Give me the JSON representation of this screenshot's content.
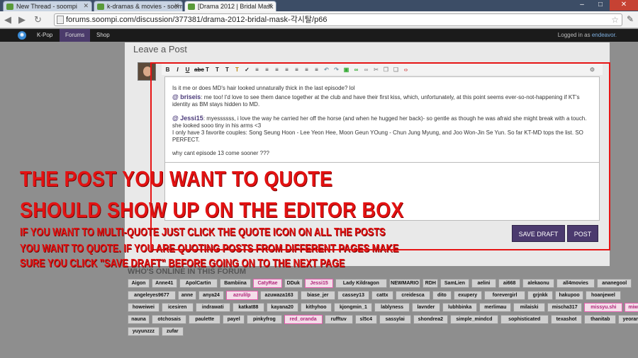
{
  "browser": {
    "tabs": [
      {
        "title": "New Thread - soompi"
      },
      {
        "title": "k-dramas & movies - soompi"
      },
      {
        "title": "[Drama 2012 | Bridal Mask"
      }
    ],
    "url": "forums.soompi.com/discussion/377381/drama-2012-bridal-mask-각시탈/p66"
  },
  "site_nav": {
    "items": [
      "K-Pop",
      "Forums",
      "Shop"
    ],
    "logged_in_label": "Logged in as",
    "username": "endeavor."
  },
  "editor": {
    "heading": "Leave a Post",
    "line1": "Is it me or does MD's hair looked unnaturally thick in the last episode? lol",
    "quote1_user": "@ briseis",
    "quote1_text": ": me too! I'd love to see them dance together at the club and have their first kiss, which, unfortunately, at this point seems ever-so-not-happening if KT's identity as BM stays hidden to MD.",
    "quote2_user": "@ Jessi15",
    "quote2_text": ":  myessssss, i love the way he carried her off the horse (and when he hugged her back)- so gentle as though he was afraid she might break with a touch. she looked sooo tiny in his arms <3",
    "line3": "I only have 3 favorite couples: Song Seung Hoon - Lee Yeon Hee, Moon Geun YOung - Chun Jung Myung, and Joo Won-Jin Se Yun. So far KT-MD tops the list. SO PERFECT.",
    "line4": "why cant episode 13 come sooner ???",
    "save_draft": "SAVE DRAFT",
    "post": "POST"
  },
  "overlay": {
    "line1": "THE POST YOU WANT TO QUOTE",
    "line2": "SHOULD SHOW UP ON THE EDITOR BOX",
    "line3": "IF YOU WANT TO MULTI-QUOTE JUST CLICK THE QUOTE ICON ON ALL THE POSTS",
    "line4": "YOU WANT TO QUOTE. IF YOU ARE QUOTING POSTS FROM DIFFERENT PAGES MAKE",
    "line5": "SURE YOU CLICK \"SAVE DRAFT\" BEFORE GOING ON TO THE NEXT PAGE"
  },
  "online": {
    "heading": "WHO'S ONLINE IN THIS FORUM",
    "rows": [
      [
        "Aigon",
        "Anne41",
        "ApolCartin",
        "Bambiina",
        "CatyRae",
        "DDuk",
        "Jessi15",
        "Lady Kildragon",
        "NEWMARIO",
        "RDH",
        "SamLien",
        "aelini",
        "ai668",
        "alekaonu",
        "all4movies",
        "ananegool"
      ],
      [
        "angeleyes9677",
        "anne",
        "anya24",
        "azrulilp",
        "azuwaza163",
        "biase_jer",
        "cassey13",
        "cattx",
        "creidesca",
        "dito",
        "exupery",
        "forevergirl",
        "grjnkk",
        "hakupoo",
        "hoanjewel"
      ],
      [
        "howeiwei",
        "icesiren",
        "indrawati",
        "katkat88",
        "kayana20",
        "kithyhoo",
        "kjongmin_1",
        "lablyness",
        "lavnder",
        "lubhbinka",
        "merlimau",
        "milaiski",
        "mischa317",
        "missyu.shi",
        "miwako"
      ],
      [
        "nauna",
        "otchosais",
        "paulette",
        "payel",
        "pinkyfrog",
        "red_oranda",
        "rufftuv",
        "sl5c4",
        "sassylai",
        "shondrea2",
        "simple_mindcd",
        "sophisticated",
        "texashot",
        "thanitab",
        "yeoran"
      ],
      [
        "yuyunzzz",
        "zufar"
      ]
    ]
  }
}
